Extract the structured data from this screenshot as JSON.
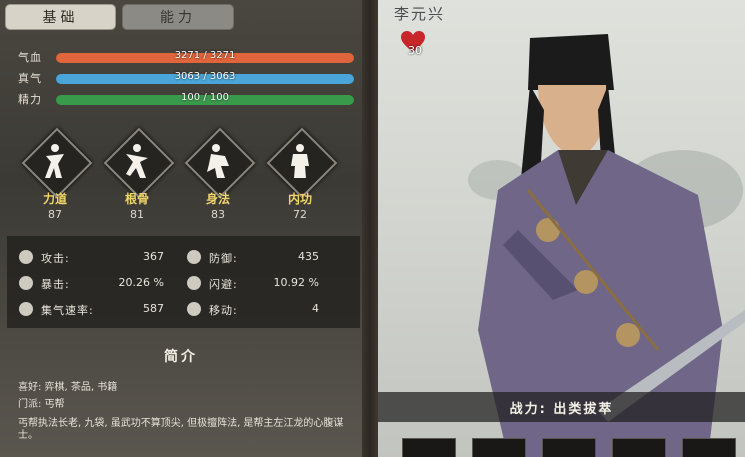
{
  "tabs": [
    {
      "label": "基础"
    },
    {
      "label": "能力"
    }
  ],
  "bars": [
    {
      "label": "气血",
      "value": "3271 / 3271",
      "color": "#e0653c"
    },
    {
      "label": "真气",
      "value": "3063 / 3063",
      "color": "#4aa6d8"
    },
    {
      "label": "精力",
      "value": "100 / 100",
      "color": "#3a9a4c"
    }
  ],
  "attributes": [
    {
      "name": "力道",
      "value": "87"
    },
    {
      "name": "根骨",
      "value": "81"
    },
    {
      "name": "身法",
      "value": "83"
    },
    {
      "name": "内功",
      "value": "72"
    }
  ],
  "stats": [
    {
      "label": "攻击:",
      "value": "367",
      "icon": "sword-icon"
    },
    {
      "label": "防御:",
      "value": "435",
      "icon": "shield-icon"
    },
    {
      "label": "暴击:",
      "value": "20.26 %",
      "icon": "crit-icon"
    },
    {
      "label": "闪避:",
      "value": "10.92 %",
      "icon": "dodge-icon"
    },
    {
      "label": "集气速率:",
      "value": "587",
      "icon": "qi-icon"
    },
    {
      "label": "移动:",
      "value": "4",
      "icon": "move-icon"
    }
  ],
  "intro": {
    "title": "简介",
    "hobby": "喜好: 弈棋, 茶品, 书籍",
    "sect": "门派: 丐帮",
    "description": "丐帮执法长老, 九袋, 虽武功不算顶尖, 但极擅阵法, 是帮主左江龙的心腹谋士。"
  },
  "character": {
    "name": "李元兴",
    "favor": "30",
    "power": "战力: 出类拔萃"
  },
  "colors": {
    "accent": "#f1d66a",
    "heart": "#c8262a"
  }
}
